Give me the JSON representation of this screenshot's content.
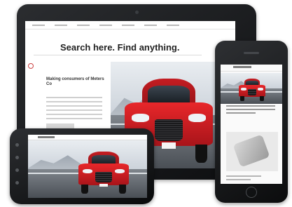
{
  "tablet": {
    "headline": "Search here. Find anything.",
    "side_title": "Making consumers of Meters Co"
  },
  "colors": {
    "car_red": "#d81f26",
    "device_black": "#111214",
    "screen_bg": "#ffffff"
  },
  "icons": {
    "tablet_camera": "camera-dot",
    "phone_speaker": "speaker-slot",
    "phone_home": "home-button-circle"
  }
}
